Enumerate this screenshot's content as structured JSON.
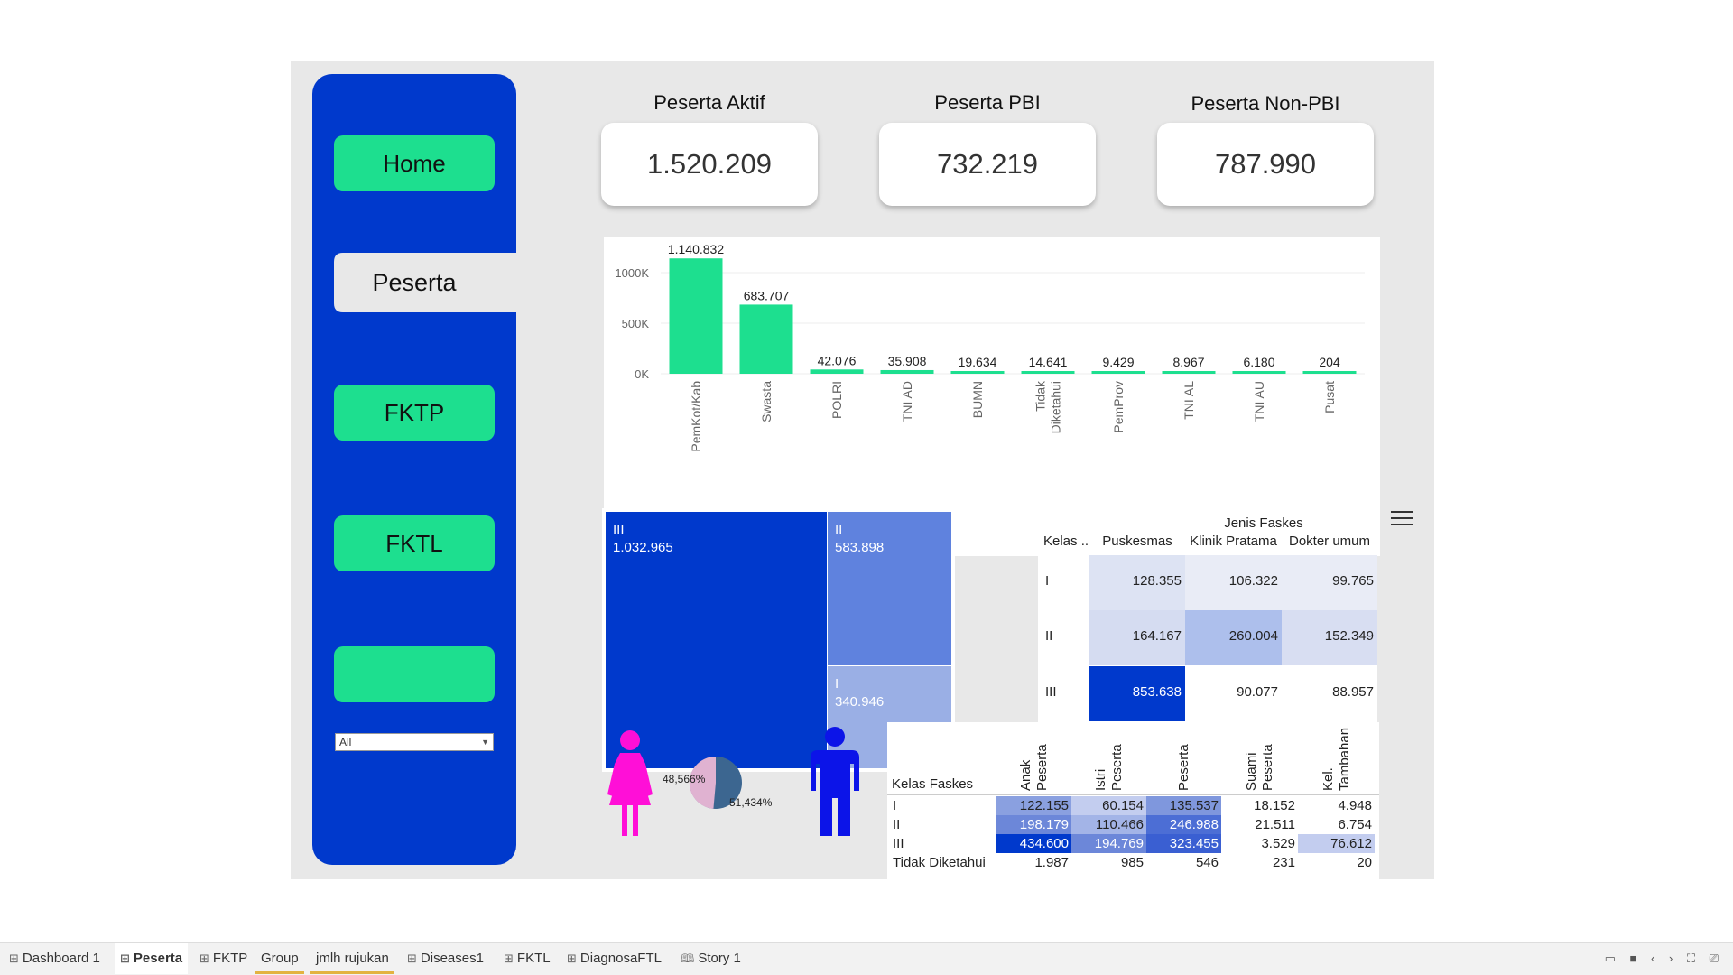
{
  "nav": {
    "home": "Home",
    "peserta": "Peserta",
    "fktp": "FKTP",
    "fktl": "FKTL",
    "blank": "",
    "filter_value": "All"
  },
  "kpis": [
    {
      "title": "Peserta Aktif",
      "value": "1.520.209"
    },
    {
      "title": "Peserta PBI",
      "value": "732.219"
    },
    {
      "title": "Peserta Non-PBI",
      "value": "787.990"
    }
  ],
  "chart_data": {
    "type": "bar",
    "categories": [
      "PemKot/Kab",
      "Swasta",
      "POLRI",
      "TNI AD",
      "BUMN",
      "Tidak Diketahui",
      "PemProv",
      "TNI AL",
      "TNI AU",
      "Pusat"
    ],
    "category_lines": [
      [
        "PemKot/Kab"
      ],
      [
        "Swasta"
      ],
      [
        "POLRI"
      ],
      [
        "TNI AD"
      ],
      [
        "BUMN"
      ],
      [
        "Tidak",
        "Diketahui"
      ],
      [
        "PemProv"
      ],
      [
        "TNI AL"
      ],
      [
        "TNI AU"
      ],
      [
        "Pusat"
      ]
    ],
    "values": [
      1140832,
      683707,
      42076,
      35908,
      19634,
      14641,
      9429,
      8967,
      6180,
      204
    ],
    "value_labels": [
      "1.140.832",
      "683.707",
      "42.076",
      "35.908",
      "19.634",
      "14.641",
      "9.429",
      "8.967",
      "6.180",
      "204"
    ],
    "ticks": [
      0,
      500000,
      1000000
    ],
    "tick_labels": [
      "0K",
      "500K",
      "1000K"
    ],
    "ylim": [
      0,
      1250000
    ],
    "color": "#1ddf8f",
    "grid": true
  },
  "treemap": {
    "items": [
      {
        "label": "III",
        "value": "1.032.965",
        "color": "#0039cc"
      },
      {
        "label": "II",
        "value": "583.898",
        "color": "#5f82de"
      },
      {
        "label": "I",
        "value": "340.946",
        "color": "#9aafe5"
      }
    ]
  },
  "faskes_table": {
    "header_group": "Jenis Faskes",
    "row_header": "Kelas ..",
    "columns": [
      "Puskesmas",
      "Klinik Pratama",
      "Dokter umum"
    ],
    "rows": [
      {
        "label": "I",
        "cells": [
          "128.355",
          "106.322",
          "99.765"
        ],
        "colors": [
          "#dde3f3",
          "#e9ecf6",
          "#e9ecf6"
        ]
      },
      {
        "label": "II",
        "cells": [
          "164.167",
          "260.004",
          "152.349"
        ],
        "colors": [
          "#d5dcf1",
          "#adbfec",
          "#d8def2"
        ]
      },
      {
        "label": "III",
        "cells": [
          "853.638",
          "90.077",
          "88.957"
        ],
        "colors": [
          "#0039cc",
          "#ffffff",
          "#ffffff"
        ]
      }
    ]
  },
  "gender": {
    "female_pct": "48,566%",
    "male_pct": "51,434%",
    "female_color": "#ff0fd7",
    "male_color": "#0c14e8",
    "pie_colors": [
      "#e0b2d1",
      "#3c6690"
    ]
  },
  "relation_table": {
    "row_header": "Kelas Faskes",
    "columns": [
      [
        "Anak",
        "Peserta"
      ],
      [
        "Istri",
        "Peserta"
      ],
      [
        "Peserta"
      ],
      [
        "Suami",
        "Peserta"
      ],
      [
        "Kel.",
        "Tambahan"
      ]
    ],
    "rows": [
      {
        "label": "I",
        "cells": [
          "122.155",
          "60.154",
          "135.537",
          "18.152",
          "4.948"
        ],
        "colors": [
          "#8aa0e0",
          "#c3cdef",
          "#7f97dd",
          "#ffffff",
          "#ffffff"
        ]
      },
      {
        "label": "II",
        "cells": [
          "198.179",
          "110.466",
          "246.988",
          "21.511",
          "6.754"
        ],
        "colors": [
          "#6c87d9",
          "#a3b4e7",
          "#4c6ed5",
          "#ffffff",
          "#ffffff"
        ]
      },
      {
        "label": "III",
        "cells": [
          "434.600",
          "194.769",
          "323.455",
          "3.529",
          "76.612"
        ],
        "colors": [
          "#0039cc",
          "#6c87d9",
          "#3a5fd2",
          "#ffffff",
          "#c3cdef"
        ]
      },
      {
        "label": "Tidak Diketahui",
        "cells": [
          "1.987",
          "985",
          "546",
          "231",
          "20"
        ],
        "colors": [
          "#ffffff",
          "#ffffff",
          "#ffffff",
          "#ffffff",
          "#ffffff"
        ]
      }
    ]
  },
  "tabs": [
    {
      "label": "Dashboard 1",
      "icon": "dashboard-grid-icon",
      "glyph": "⊞"
    },
    {
      "label": "Peserta",
      "icon": "dashboard-grid-icon",
      "glyph": "⊞"
    },
    {
      "label": "FKTP",
      "icon": "dashboard-grid-icon",
      "glyph": "⊞"
    },
    {
      "label": "Group",
      "icon": "",
      "glyph": ""
    },
    {
      "label": "jmlh rujukan",
      "icon": "",
      "glyph": ""
    },
    {
      "label": "Diseases1",
      "icon": "dashboard-grid-icon",
      "glyph": "⊞"
    },
    {
      "label": "FKTL",
      "icon": "dashboard-grid-icon",
      "glyph": "⊞"
    },
    {
      "label": "DiagnosaFTL",
      "icon": "dashboard-grid-icon",
      "glyph": "⊞"
    },
    {
      "label": "Story 1",
      "icon": "story-book-icon",
      "glyph": "🕮"
    }
  ],
  "active_tab": "Peserta"
}
